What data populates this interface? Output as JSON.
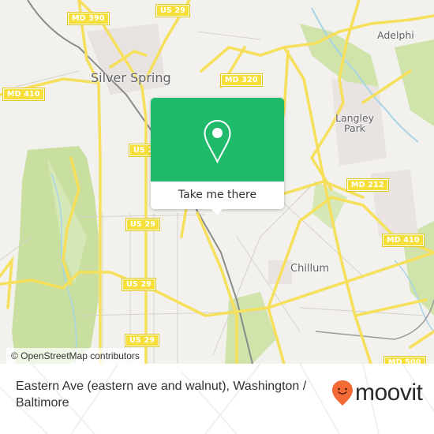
{
  "map": {
    "attribution": "© OpenStreetMap contributors",
    "place_labels": {
      "silver_spring": "Silver Spring",
      "adelphi": "Adelphi",
      "langley_park_1": "Langley",
      "langley_park_2": "Park",
      "chillum": "Chillum"
    },
    "road_shields": {
      "md390": "MD 390",
      "us29_top": "US 29",
      "md320": "MD 320",
      "md410_left": "MD 410",
      "us29_a": "US 29",
      "us29_b": "US 29",
      "us29_c": "US 29",
      "us29_d": "US 29",
      "md212": "MD 212",
      "md410_right": "MD 410",
      "md500": "MD 500"
    },
    "colors": {
      "background": "#f2f1ed",
      "park": "#c8dfa0",
      "road_major": "#f6df5a",
      "water": "#a8d4e6",
      "rail": "#8a8a8a"
    }
  },
  "popup": {
    "icon": "map-pin-icon",
    "button_label": "Take me there",
    "color": "#1fba6a"
  },
  "footer": {
    "title": "Eastern Ave (eastern ave and walnut), Washington / Baltimore",
    "logo_text": "moovit",
    "logo_color": "#f26a36"
  }
}
